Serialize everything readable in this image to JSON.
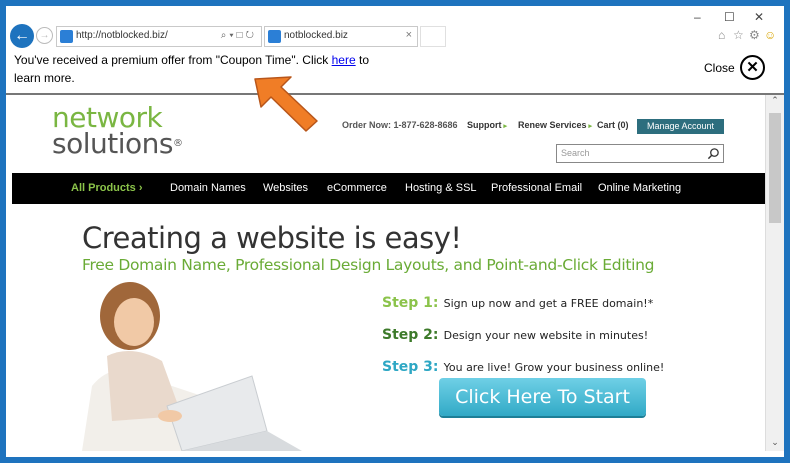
{
  "browser": {
    "url": "http://notblocked.biz/",
    "tab_title": "notblocked.biz",
    "tab_close": "×",
    "window_controls": [
      "–",
      "☐",
      "✕"
    ],
    "toolbar_icons": [
      "home-icon",
      "star-icon",
      "gear-icon",
      "smiley-icon"
    ]
  },
  "notification": {
    "message_before": "You've received a premium offer from \"Coupon Time\". Click ",
    "link_text": "here",
    "message_after": " to learn more.",
    "close_label": "Close"
  },
  "site": {
    "logo_line1": "network",
    "logo_line2": "solutions",
    "logo_reg": "®",
    "order_now": "Order Now: 1-877-628-8686",
    "support": "Support",
    "renew": "Renew Services",
    "cart": "Cart (0)",
    "manage_account": "Manage Account",
    "search_placeholder": "Search",
    "nav": [
      "All Products ›",
      "Domain Names",
      "Websites",
      "eCommerce",
      "Hosting & SSL",
      "Professional Email",
      "Online Marketing"
    ],
    "hero_title": "Creating a website is easy!",
    "hero_subtitle": "Free Domain Name, Professional Design Layouts, and Point-and-Click Editing",
    "steps": [
      {
        "label": "Step 1:",
        "text": "Sign up now and get a FREE domain!*",
        "color": "#8bc34a"
      },
      {
        "label": "Step 2:",
        "text": "Design your new website in minutes!",
        "color": "#3d7a2a"
      },
      {
        "label": "Step 3:",
        "text": "You are live! Grow your business online!",
        "color": "#2ea7c4"
      }
    ],
    "cta": "Click Here To Start"
  },
  "colors": {
    "frame": "#1e73be",
    "brand_green": "#7ab642",
    "manage_button": "#2d6e7e",
    "cta": "#31a9c6",
    "arrow": "#f07d26"
  }
}
